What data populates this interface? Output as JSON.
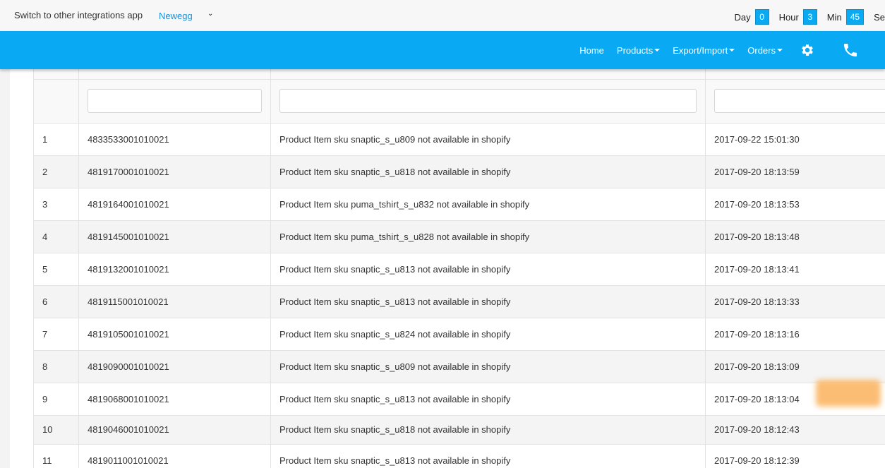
{
  "topbar": {
    "switch_label": "Switch to other integrations app",
    "selected_app": "Newegg",
    "timer": [
      {
        "label": "Day",
        "value": "0"
      },
      {
        "label": "Hour",
        "value": "3"
      },
      {
        "label": "Min",
        "value": "45"
      },
      {
        "label": "Se",
        "value": ""
      }
    ]
  },
  "nav": {
    "home": "Home",
    "products": "Products",
    "export_import": "Export/Import",
    "orders": "Orders"
  },
  "colors": {
    "nav_bg": "#0aa9f4",
    "timer_box": "#09aaf1",
    "link": "#1a8fd8"
  },
  "table": {
    "rows": [
      {
        "num": "1",
        "id": "4833533001010021",
        "message": "Product Item sku snaptic_s_u809 not available in shopify",
        "time": "2017-09-22 15:01:30"
      },
      {
        "num": "2",
        "id": "4819170001010021",
        "message": "Product Item sku snaptic_s_u818 not available in shopify",
        "time": "2017-09-20 18:13:59"
      },
      {
        "num": "3",
        "id": "4819164001010021",
        "message": "Product Item sku puma_tshirt_s_u832 not available in shopify",
        "time": "2017-09-20 18:13:53"
      },
      {
        "num": "4",
        "id": "4819145001010021",
        "message": "Product Item sku puma_tshirt_s_u828 not available in shopify",
        "time": "2017-09-20 18:13:48"
      },
      {
        "num": "5",
        "id": "4819132001010021",
        "message": "Product Item sku snaptic_s_u813 not available in shopify",
        "time": "2017-09-20 18:13:41"
      },
      {
        "num": "6",
        "id": "4819115001010021",
        "message": "Product Item sku snaptic_s_u813 not available in shopify",
        "time": "2017-09-20 18:13:33"
      },
      {
        "num": "7",
        "id": "4819105001010021",
        "message": "Product Item sku snaptic_s_u824 not available in shopify",
        "time": "2017-09-20 18:13:16"
      },
      {
        "num": "8",
        "id": "4819090001010021",
        "message": "Product Item sku snaptic_s_u809 not available in shopify",
        "time": "2017-09-20 18:13:09"
      },
      {
        "num": "9",
        "id": "4819068001010021",
        "message": "Product Item sku snaptic_s_u813 not available in shopify",
        "time": "2017-09-20 18:13:04"
      },
      {
        "num": "10",
        "id": "4819046001010021",
        "message": "Product Item sku snaptic_s_u818 not available in shopify",
        "time": "2017-09-20 18:12:43"
      },
      {
        "num": "11",
        "id": "4819011001010021",
        "message": "Product Item sku snaptic_s_u813 not available in shopify",
        "time": "2017-09-20 18:12:39"
      }
    ]
  }
}
